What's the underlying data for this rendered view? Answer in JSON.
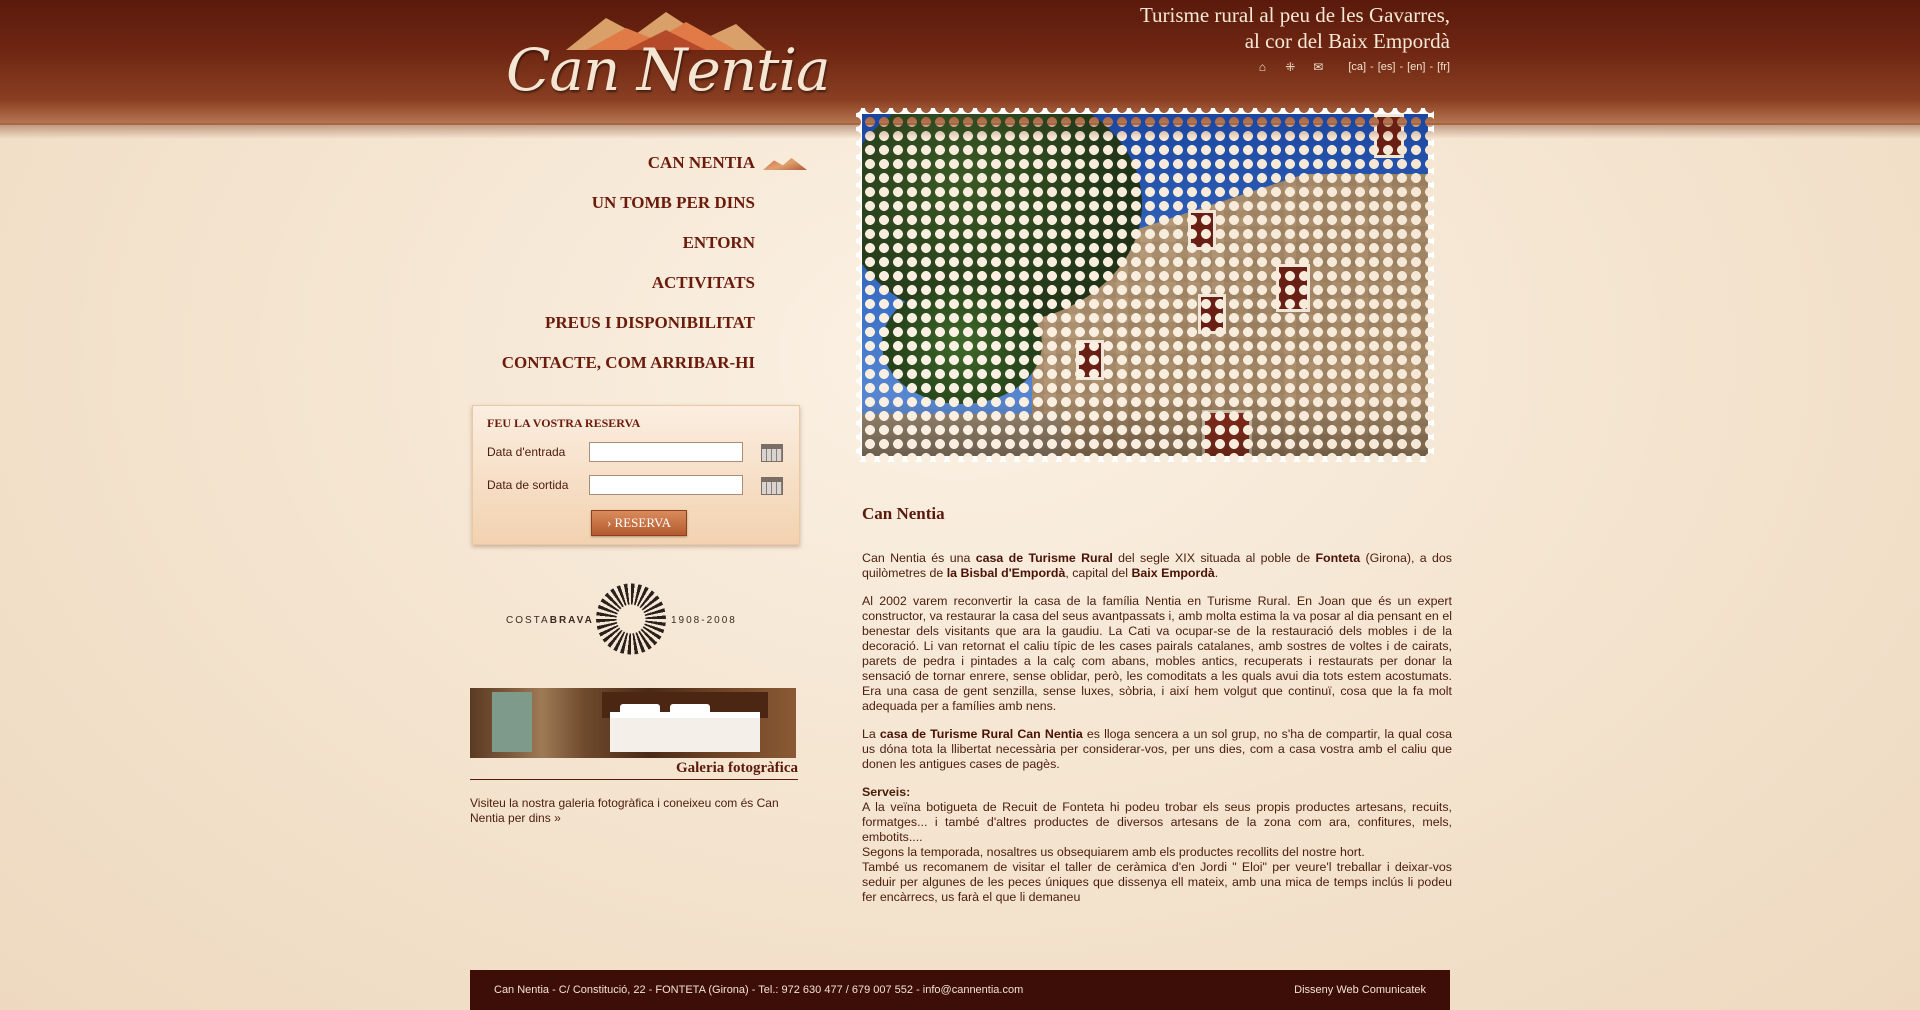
{
  "brand": {
    "logo_text": "Can Nentia",
    "tagline_line1": "Turisme rural al peu de les Gavarres,",
    "tagline_line2": "al cor del Baix Empordà"
  },
  "toolbar": {
    "icons": [
      "home-icon",
      "sitemap-icon",
      "mail-icon"
    ],
    "languages": [
      "[ca]",
      "[es]",
      "[en]",
      "[fr]"
    ],
    "separator": "-"
  },
  "nav": {
    "items": [
      {
        "label": "CAN NENTIA",
        "active": true
      },
      {
        "label": "UN TOMB PER DINS",
        "active": false
      },
      {
        "label": "ENTORN",
        "active": false
      },
      {
        "label": "ACTIVITATS",
        "active": false
      },
      {
        "label": "PREUS I DISPONIBILITAT",
        "active": false
      },
      {
        "label": "CONTACTE, COM ARRIBAR-HI",
        "active": false
      }
    ]
  },
  "reservation": {
    "title": "FEU LA VOSTRA RESERVA",
    "checkin_label": "Data d'entrada",
    "checkin_value": "",
    "checkout_label": "Data de sortida",
    "checkout_value": "",
    "button": "RESERVA"
  },
  "costa_brava": {
    "left": "COSTABRAVA",
    "left_bold": "BRAVA",
    "left_plain": "COSTA",
    "right": "1908-2008"
  },
  "gallery": {
    "title": "Galeria fotogràfica",
    "text": "Visiteu la nostra galeria fotogràfica i coneixeu com és Can Nentia per dins",
    "more": "»"
  },
  "content": {
    "heading": "Can Nentia",
    "p1": {
      "t1": "Can Nentia és una ",
      "b1": "casa de Turisme Rural",
      "t2": " del segle XIX situada al poble de ",
      "b2": "Fonteta",
      "t3": " (Girona), a dos quilòmetres de ",
      "b3": "la Bisbal d'Empordà",
      "t4": ", capital del ",
      "b4": "Baix Empordà",
      "t5": "."
    },
    "p2": "Al 2002 varem reconvertir la casa de la família Nentia en Turisme Rural. En Joan que és un expert constructor, va restaurar la casa del seus avantpassats i, amb molta estima la va posar al dia pensant en el benestar dels visitants que ara la gaudiu. La Cati va ocupar-se de la restauració dels mobles i de la decoració. Li van retornat el caliu típic de les cases pairals catalanes, amb sostres de voltes i de cairats, parets de pedra i pintades a la calç com abans, mobles antics, recuperats i restaurats per donar la sensació de tornar enrere, sense oblidar, però, les comoditats a les quals avui dia tots estem acostumats. Era una casa de gent senzilla, sense luxes, sòbria, i així hem volgut que continuï, cosa que la fa molt adequada per a famílies amb nens.",
    "p3": {
      "t1": "La ",
      "b1": "casa de Turisme Rural Can Nentia",
      "t2": " es lloga sencera a un sol grup, no s'ha de compartir, la qual cosa us dóna tota la llibertat necessària per considerar-vos, per uns dies, com a casa vostra amb el caliu que donen les antigues cases de pagès."
    },
    "services_title": "Serveis:",
    "services_1": "A la veïna botigueta de Recuit de Fonteta hi podeu trobar els seus propis productes artesans, recuits, formatges... i també d'altres productes de diversos artesans de la zona com ara, confitures, mels, embotits....",
    "services_2": "Segons la temporada, nosaltres us obsequiarem amb els productes recollits del nostre hort.",
    "services_3": "També us recomanem de visitar el taller de ceràmica d'en Jordi \" Eloi\" per veure'l treballar i deixar-vos seduir per algunes de les peces úniques que dissenya ell mateix, amb una mica de temps inclús li podeu fer encàrrecs, us farà el que li demaneu"
  },
  "footer": {
    "address": "Can Nentia - C/ Constitució, 22 - FONTETA (Girona) - Tel.: 972 630 477 / 679 007 552 - info@cannentia.com",
    "credit": "Disseny Web Comunicatek"
  },
  "colors": {
    "header": "#5a1a0b",
    "nav_text": "#6b1a0b",
    "footer_bg": "#3d0e07",
    "body_text": "#4a1d0c"
  }
}
